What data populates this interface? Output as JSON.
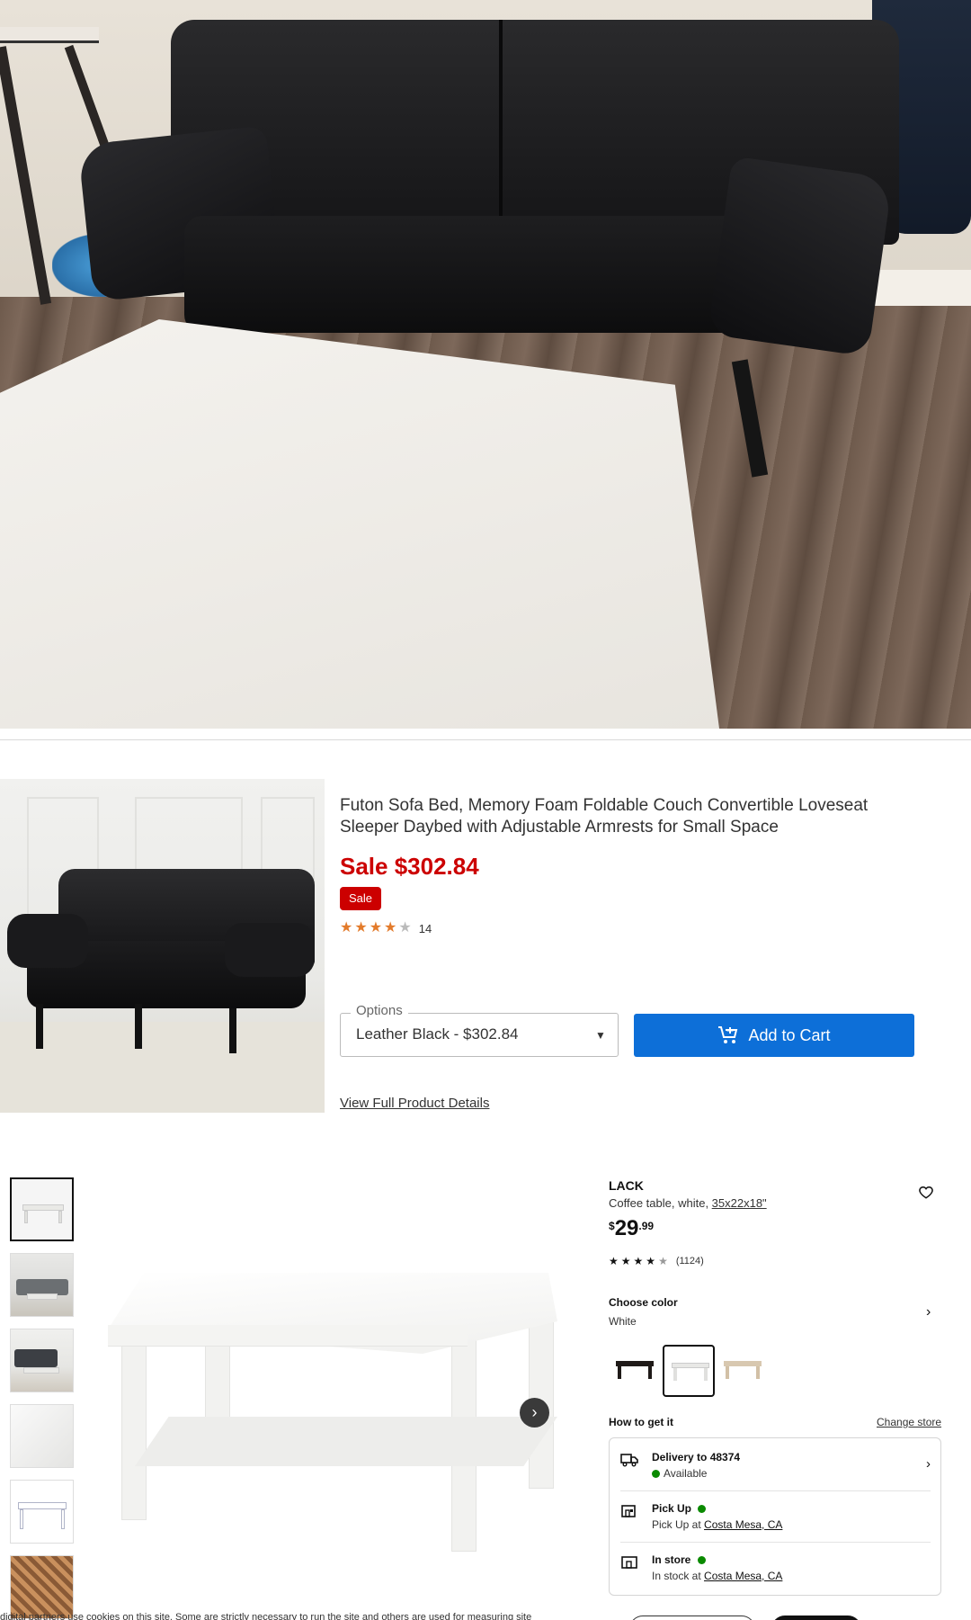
{
  "target_card": {
    "title": "Futon Sofa Bed, Memory Foam Foldable Couch Convertible Loveseat Sleeper Daybed with Adjustable Armrests for Small Space",
    "price": "Sale $302.84",
    "badge": "Sale",
    "rating_count": "14",
    "rating_value": 4.5,
    "options_label": "Options",
    "options_value": "Leather Black - $302.84",
    "add_to_cart": "Add to Cart",
    "view_details": "View Full Product Details",
    "colors": {
      "price_red": "#cc0000",
      "button_blue": "#0d6fd8"
    }
  },
  "ikea": {
    "brand": "LACK",
    "description": "Coffee table, white, ",
    "dimensions": "35x22x18\"",
    "price_currency": "$",
    "price_integer": "29",
    "price_decimal": ".99",
    "rating_count": "(1124)",
    "rating_value": 4.5,
    "choose_color_label": "Choose color",
    "choose_color_value": "White",
    "how_to_get_label": "How to get it",
    "change_store": "Change store",
    "delivery": {
      "title": "Delivery to 48374",
      "status": "Available"
    },
    "pickup": {
      "title": "Pick Up",
      "sub_prefix": "Pick Up at ",
      "location": "Costa Mesa, CA"
    },
    "instore": {
      "title": "In store",
      "sub_prefix": "In stock at ",
      "location": "Costa Mesa, CA"
    },
    "colors": {
      "available_green": "#0a8a00"
    }
  },
  "cookie": {
    "text": "digital partners use cookies on this site. Some are strictly necessary to run the site and others are used for measuring site"
  }
}
